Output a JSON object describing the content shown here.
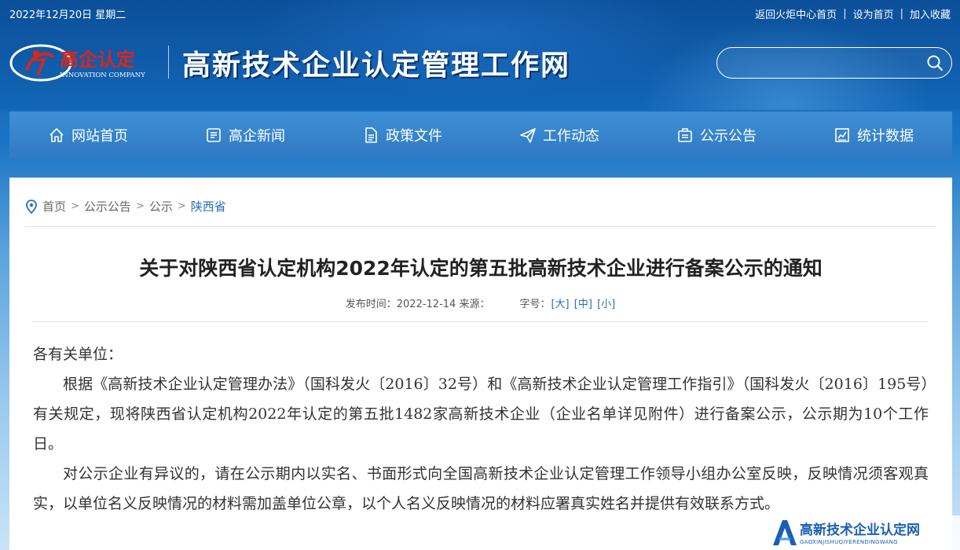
{
  "topbar": {
    "date": "2022年12月20日 星期二",
    "links": [
      "返回火炬中心首页",
      "设为首页",
      "加入收藏"
    ],
    "separator": "|"
  },
  "header": {
    "logo_cn": "高企认定",
    "logo_en": "INNOVATION COMPANY",
    "site_title": "高新技术企业认定管理工作网",
    "search_placeholder": ""
  },
  "nav": {
    "items": [
      {
        "label": "网站首页",
        "icon": "home-icon"
      },
      {
        "label": "高企新闻",
        "icon": "news-icon"
      },
      {
        "label": "政策文件",
        "icon": "document-icon"
      },
      {
        "label": "工作动态",
        "icon": "send-icon"
      },
      {
        "label": "公示公告",
        "icon": "notice-icon"
      },
      {
        "label": "统计数据",
        "icon": "chart-icon"
      }
    ]
  },
  "breadcrumb": {
    "items": [
      "首页",
      "公示公告",
      "公示",
      "陕西省"
    ],
    "separator": ">"
  },
  "article": {
    "title": "关于对陕西省认定机构2022年认定的第五批高新技术企业进行备案公示的通知",
    "meta_date": "发布时间：2022-12-14 来源：",
    "font_size_label": "字号：",
    "font_sizes": [
      "[大]",
      "[中]",
      "[小]"
    ],
    "paragraphs": [
      "各有关单位：",
      "根据《高新技术企业认定管理办法》（国科发火〔2016〕32号）和《高新技术企业认定管理工作指引》（国科发火〔2016〕195号）有关规定，现将陕西省认定机构2022年认定的第五批1482家高新技术企业（企业名单详见附件）进行备案公示，公示期为10个工作日。",
      "对公示企业有异议的，请在公示期内以实名、书面形式向全国高新技术企业认定管理工作领导小组办公室反映，反映情况须客观真实，以单位名义反映情况的材料需加盖单位公章，以个人名义反映情况的材料应署真实姓名并提供有效联系方式。"
    ]
  },
  "watermark": {
    "title": "高新技术企业认定网",
    "subtitle": "GAOXINJISHUQIYERENDINGWANG"
  },
  "colors": {
    "header_blue": "#0b4f99",
    "nav_blue": "#3f8fd6",
    "link_blue": "#2a6fb8",
    "logo_red": "#d9261c"
  }
}
